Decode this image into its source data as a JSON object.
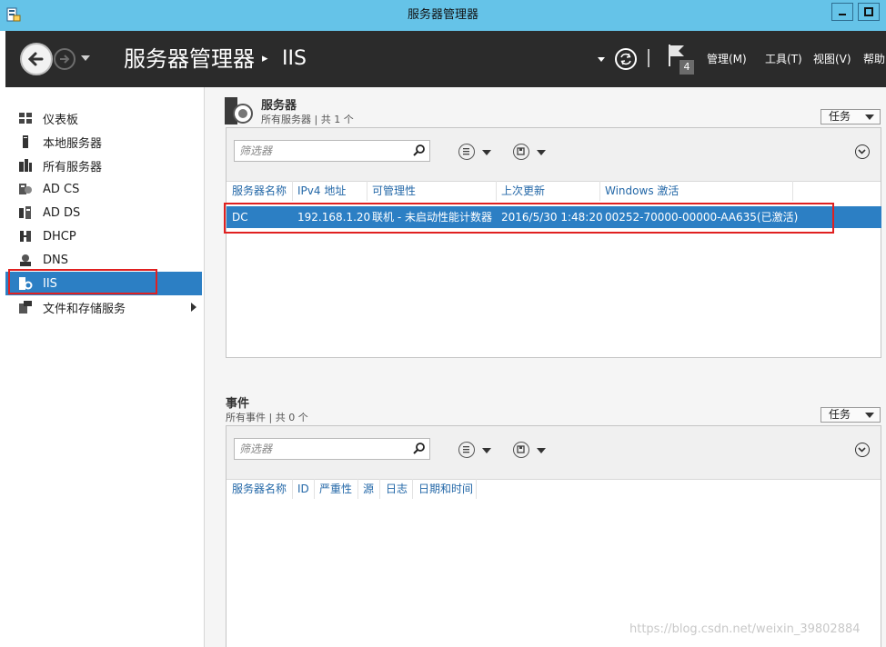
{
  "window": {
    "title": "服务器管理器",
    "minimize_glyph": "—",
    "maximize_glyph": "□"
  },
  "header": {
    "breadcrumb_root": "服务器管理器",
    "breadcrumb_separator": "▸",
    "breadcrumb_leaf": "IIS",
    "notification_count": "4",
    "menus": {
      "manage": "管理(M)",
      "tools": "工具(T)",
      "view": "视图(V)",
      "help": "帮助"
    }
  },
  "sidebar": {
    "items": [
      {
        "label": "仪表板",
        "icon": "dashboard-icon"
      },
      {
        "label": "本地服务器",
        "icon": "local-server-icon"
      },
      {
        "label": "所有服务器",
        "icon": "all-servers-icon"
      },
      {
        "label": "AD CS",
        "icon": "ad-cs-icon"
      },
      {
        "label": "AD DS",
        "icon": "ad-ds-icon"
      },
      {
        "label": "DHCP",
        "icon": "dhcp-icon"
      },
      {
        "label": "DNS",
        "icon": "dns-icon"
      },
      {
        "label": "IIS",
        "icon": "iis-icon",
        "selected": true
      },
      {
        "label": "文件和存储服务",
        "icon": "file-storage-icon",
        "has_submenu": true
      }
    ]
  },
  "servers_section": {
    "title": "服务器",
    "subtitle": "所有服务器 | 共 1 个",
    "tasks_label": "任务",
    "filter_placeholder": "筛选器",
    "columns": [
      "服务器名称",
      "IPv4 地址",
      "可管理性",
      "上次更新",
      "Windows 激活"
    ],
    "rows": [
      [
        "DC",
        "192.168.1.20",
        "联机 - 未启动性能计数器",
        "2016/5/30 1:48:20",
        "00252-70000-00000-AA635(已激活)"
      ]
    ]
  },
  "events_section": {
    "title": "事件",
    "subtitle": "所有事件 | 共 0 个",
    "tasks_label": "任务",
    "filter_placeholder": "筛选器",
    "columns": [
      "服务器名称",
      "ID",
      "严重性",
      "源",
      "日志",
      "日期和时间"
    ]
  },
  "watermark": "https://blog.csdn.net/weixin_39802884",
  "colors": {
    "titlebar": "#65c3e8",
    "header": "#2b2b2b",
    "selection": "#2c7fc4",
    "highlight_outline": "#e02020",
    "column_text": "#2468a8"
  }
}
